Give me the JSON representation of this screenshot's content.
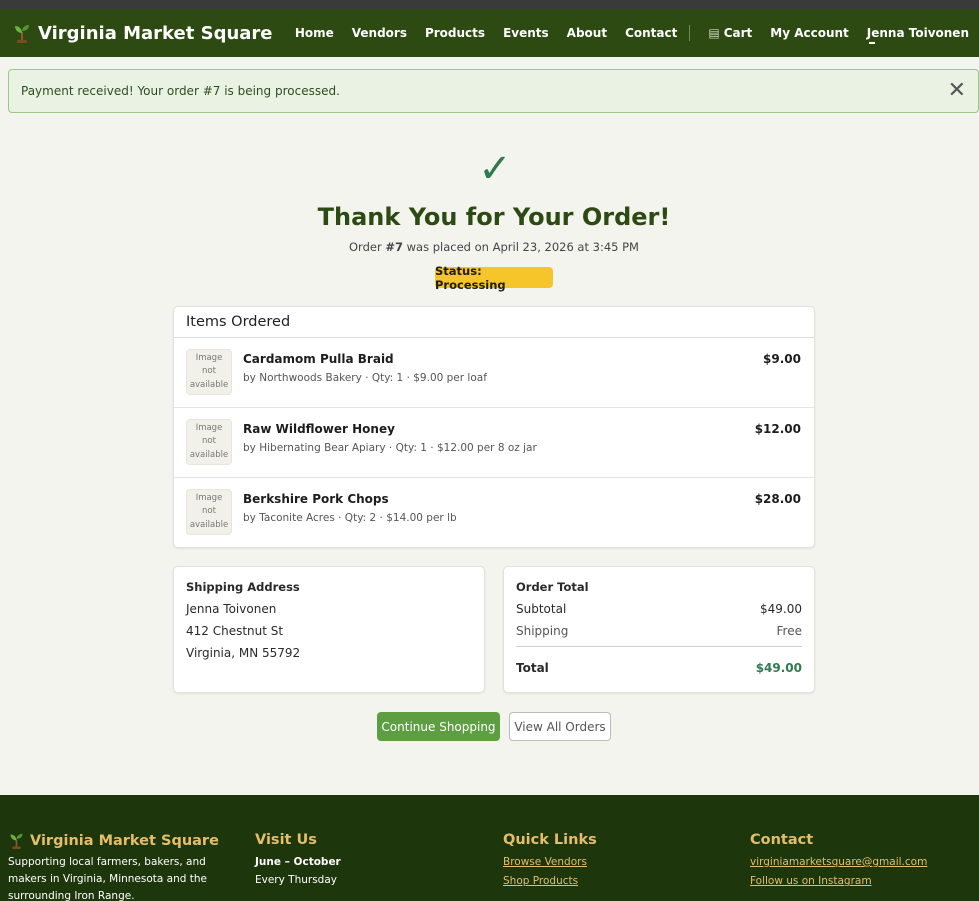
{
  "nav": {
    "brand": "Virginia Market Square",
    "links": [
      "Home",
      "Vendors",
      "Products",
      "Events",
      "About",
      "Contact"
    ],
    "cart_icon": "cart-icon",
    "cart_label": "Cart",
    "account_label": "My Account",
    "user_name": "Jenna Toivonen",
    "colors": {
      "bar": "#2c4a12",
      "text": "#ffffff"
    }
  },
  "alert": {
    "message": "Payment received! Your order #7 is being processed.",
    "close_icon": "close-icon",
    "color": "#eaf3e3"
  },
  "confirmation": {
    "check_icon": "checkmark-icon",
    "title": "Thank You for Your Order!",
    "order_prefix": "Order ",
    "order_number": "#7",
    "order_suffix": " was placed on April 23, 2026 at 3:45 PM",
    "status": "Status: Processing",
    "status_color": "#f5c52a"
  },
  "items": {
    "header": "Items Ordered",
    "image_placeholder": "Image not available",
    "list": [
      {
        "name": "Cardamom Pulla Braid",
        "details": "by Northwoods Bakery · Qty: 1 · $9.00 per loaf",
        "price": "$9.00"
      },
      {
        "name": "Raw Wildflower Honey",
        "details": "by Hibernating Bear Apiary · Qty: 1 · $12.00 per 8 oz jar",
        "price": "$12.00"
      },
      {
        "name": "Berkshire Pork Chops",
        "details": "by Taconite Acres · Qty: 2 · $14.00 per lb",
        "price": "$28.00"
      }
    ]
  },
  "shipping": {
    "title": "Shipping Address",
    "name": "Jenna Toivonen",
    "street": "412 Chestnut St",
    "city": "Virginia, MN 55792"
  },
  "totals": {
    "title": "Order Total",
    "subtotal_label": "Subtotal",
    "subtotal_value": "$49.00",
    "shipping_label": "Shipping",
    "shipping_value": "Free",
    "total_label": "Total",
    "total_value": "$49.00",
    "total_color": "#2f7a4f"
  },
  "actions": {
    "continue_label": "Continue Shopping",
    "orders_label": "View All Orders",
    "primary_color": "#5e9e43"
  },
  "footer": {
    "brand": "Virginia Market Square",
    "tagline": "Supporting local farmers, bakers, and makers in Virginia, Minnesota and the surrounding Iron Range.",
    "visit_heading": "Visit Us",
    "season": "June – October",
    "schedule": "Every Thursday",
    "links_heading": "Quick Links",
    "link_vendors": "Browse Vendors",
    "link_products": "Shop Products",
    "contact_heading": "Contact",
    "email": "virginiamarketsquare@gmail.com",
    "instagram": "Follow us on Instagram",
    "colors": {
      "background": "#1e360c",
      "heading": "#e4be6a"
    }
  }
}
